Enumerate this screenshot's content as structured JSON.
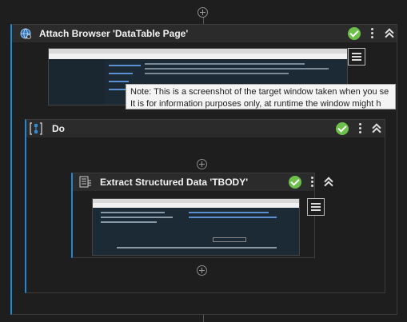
{
  "attach_browser": {
    "title": "Attach Browser 'DataTable Page'"
  },
  "tooltip": {
    "line1": "Note: This is a screenshot of the target window taken when you se",
    "line2": "It is for information purposes only, at runtime the window might h"
  },
  "do_sequence": {
    "title": "Do"
  },
  "extract_data": {
    "title": "Extract Structured Data 'TBODY'"
  },
  "colors": {
    "accent": "#1e8ad6",
    "success": "#6cc04a",
    "background": "#1e1e1e",
    "header": "#2b2b2b"
  }
}
